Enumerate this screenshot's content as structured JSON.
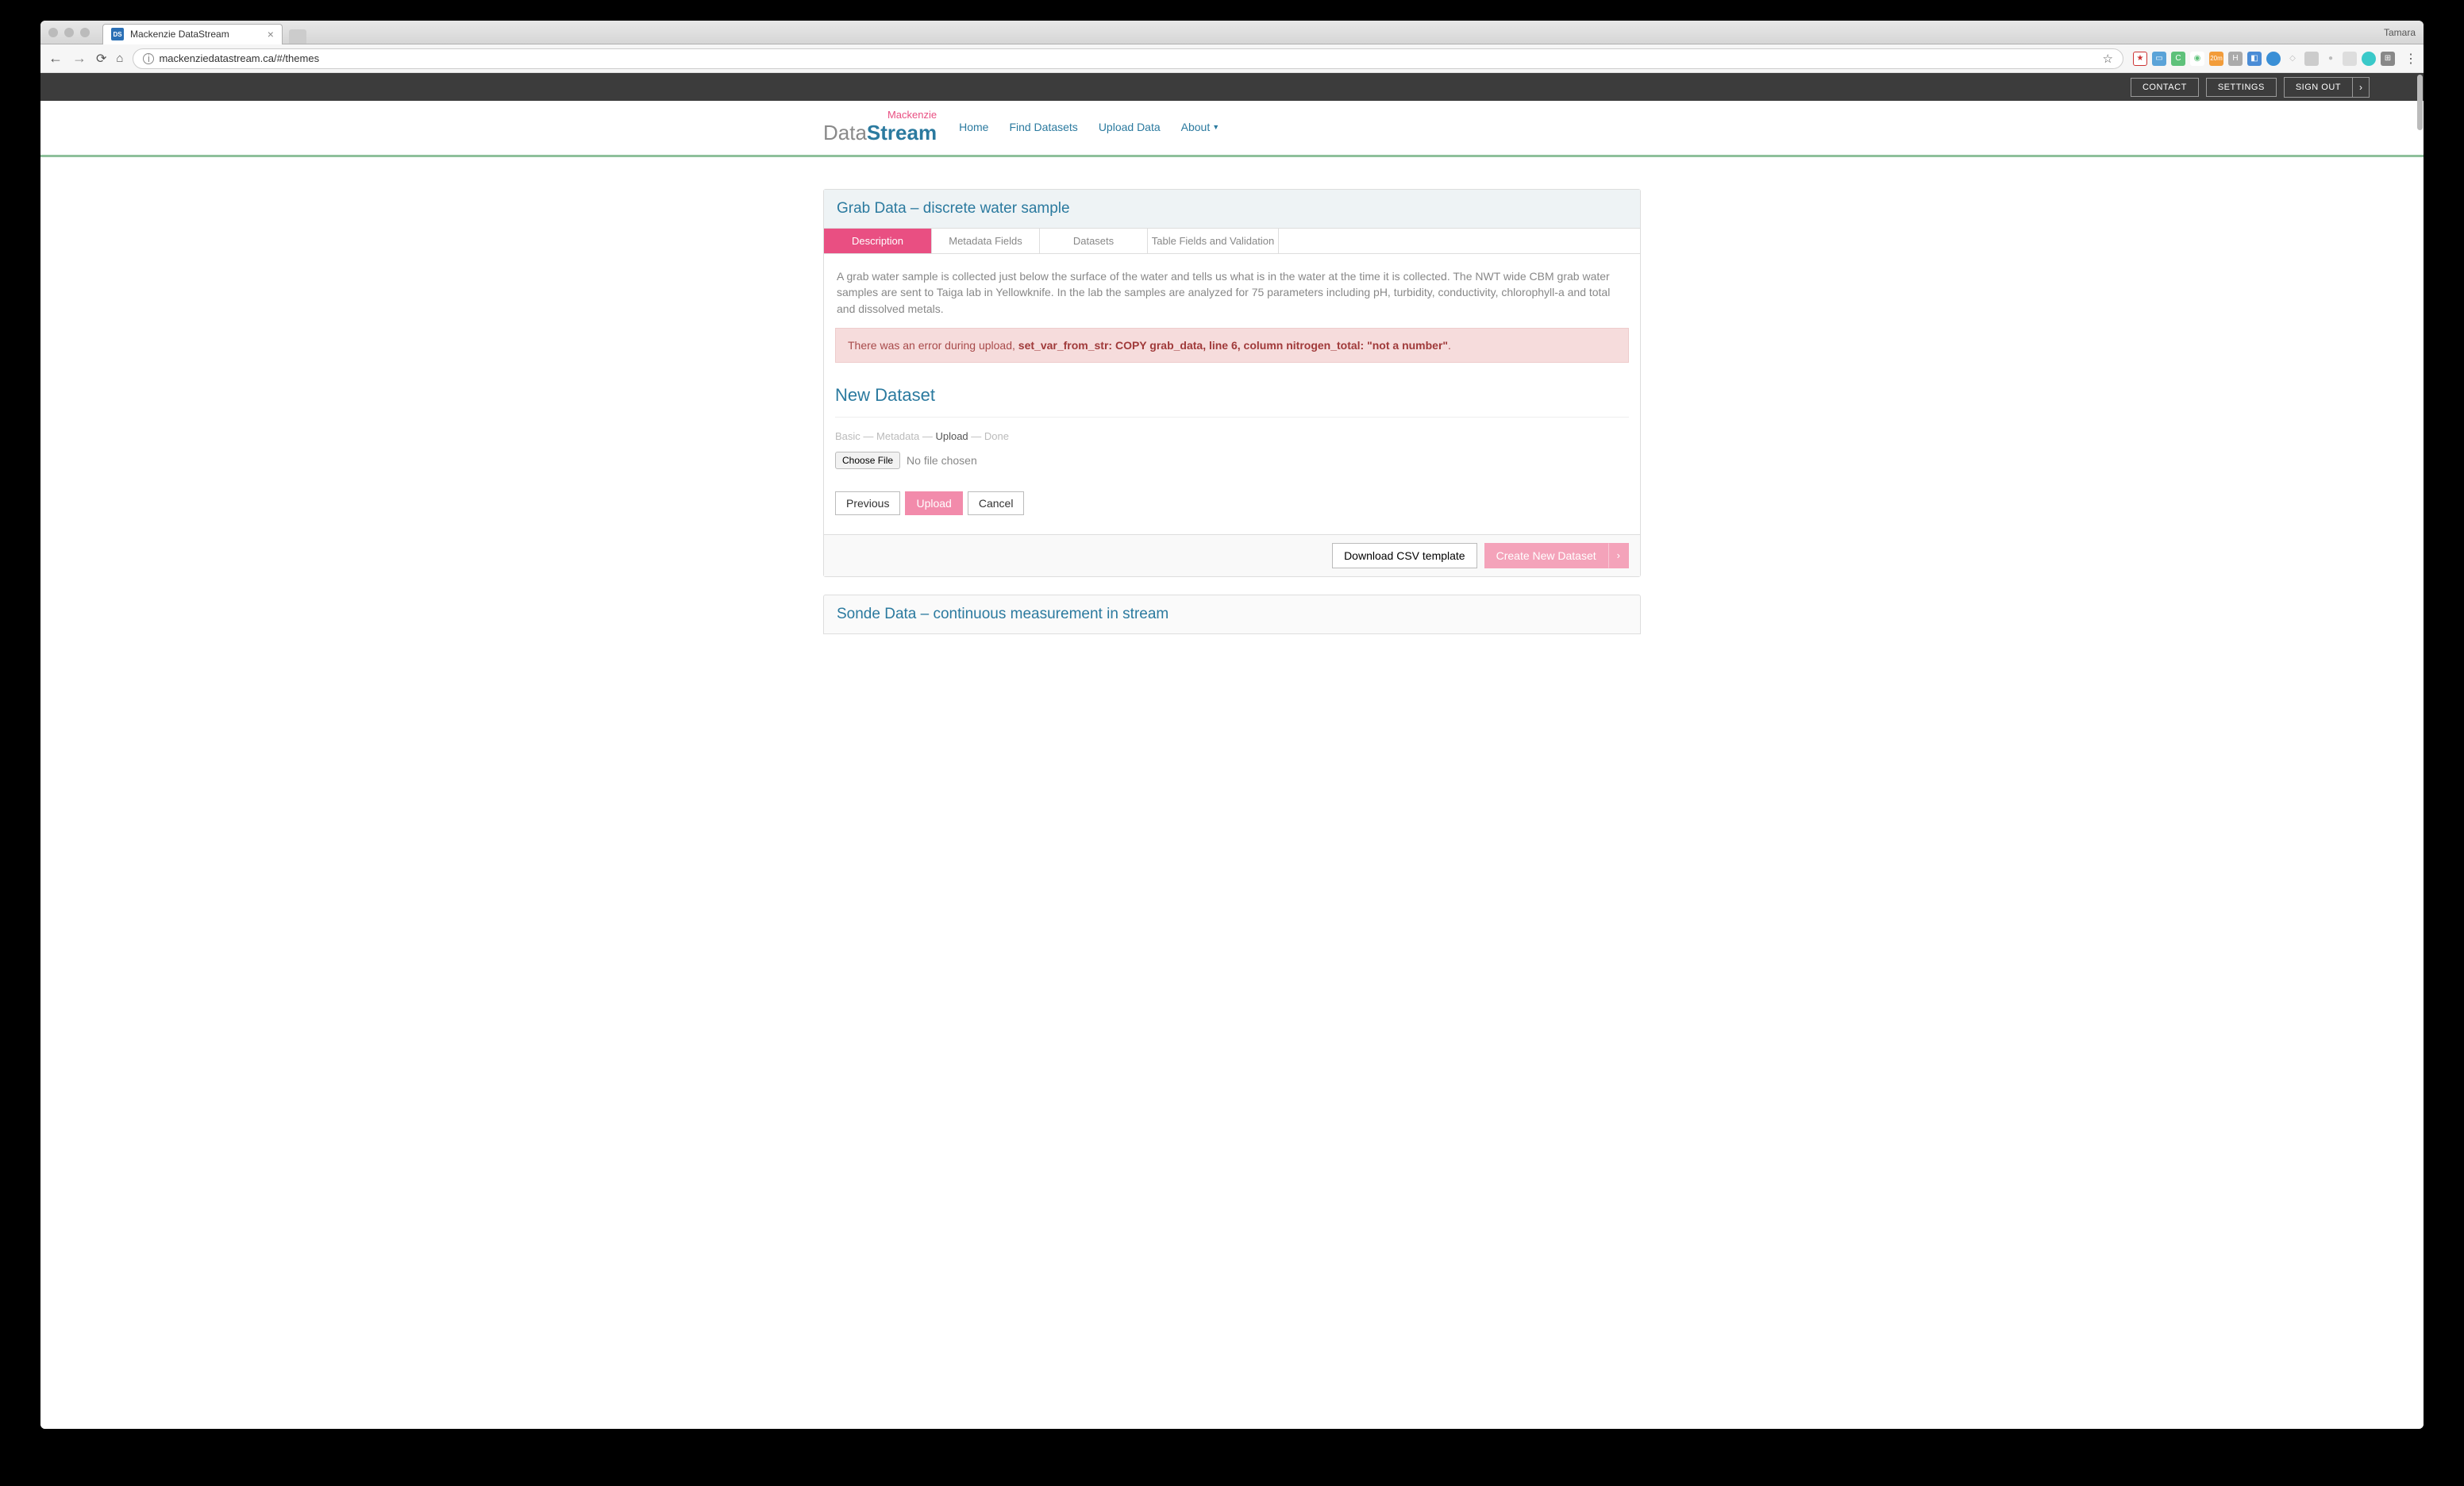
{
  "browser": {
    "tab_title": "Mackenzie DataStream",
    "favicon_text": "DS",
    "user_name": "Tamara",
    "url": "mackenziedatastream.ca/#/themes"
  },
  "topbar": {
    "contact": "CONTACT",
    "settings": "SETTINGS",
    "signout": "SIGN OUT"
  },
  "logo": {
    "top": "Mackenzie",
    "data": "Data",
    "stream": "Stream"
  },
  "nav": {
    "home": "Home",
    "find": "Find Datasets",
    "upload": "Upload Data",
    "about": "About"
  },
  "panel1": {
    "title": "Grab Data – discrete water sample",
    "tabs": {
      "description": "Description",
      "metadata": "Metadata Fields",
      "datasets": "Datasets",
      "validation": "Table Fields and Validation"
    },
    "description": "A grab water sample is collected just below the surface of the water and tells us what is in the water at the time it is collected. The NWT wide CBM grab water samples are sent to Taiga lab in Yellowknife. In the lab the samples are analyzed for 75 parameters including pH, turbidity, conductivity, chlorophyll-a and total and dissolved metals.",
    "error_prefix": "There was an error during upload, ",
    "error_bold": "set_var_from_str: COPY grab_data, line 6, column nitrogen_total: \"not a number\"",
    "error_suffix": ".",
    "new_dataset": "New Dataset",
    "breadcrumb": {
      "basic": "Basic",
      "metadata": "Metadata",
      "upload": "Upload",
      "done": "Done",
      "sep": " — "
    },
    "choose_file": "Choose File",
    "no_file": "No file chosen",
    "btn_previous": "Previous",
    "btn_upload": "Upload",
    "btn_cancel": "Cancel",
    "footer_download": "Download CSV template",
    "footer_create": "Create New Dataset"
  },
  "panel2": {
    "title": "Sonde Data – continuous measurement in stream"
  },
  "colors": {
    "brand_blue": "#2b7a9f",
    "brand_pink": "#e94f82",
    "brand_green": "#8ec09b",
    "topbar_bg": "#3c3c3c",
    "error_bg": "#f6dcdc",
    "error_text": "#a84a4a"
  }
}
